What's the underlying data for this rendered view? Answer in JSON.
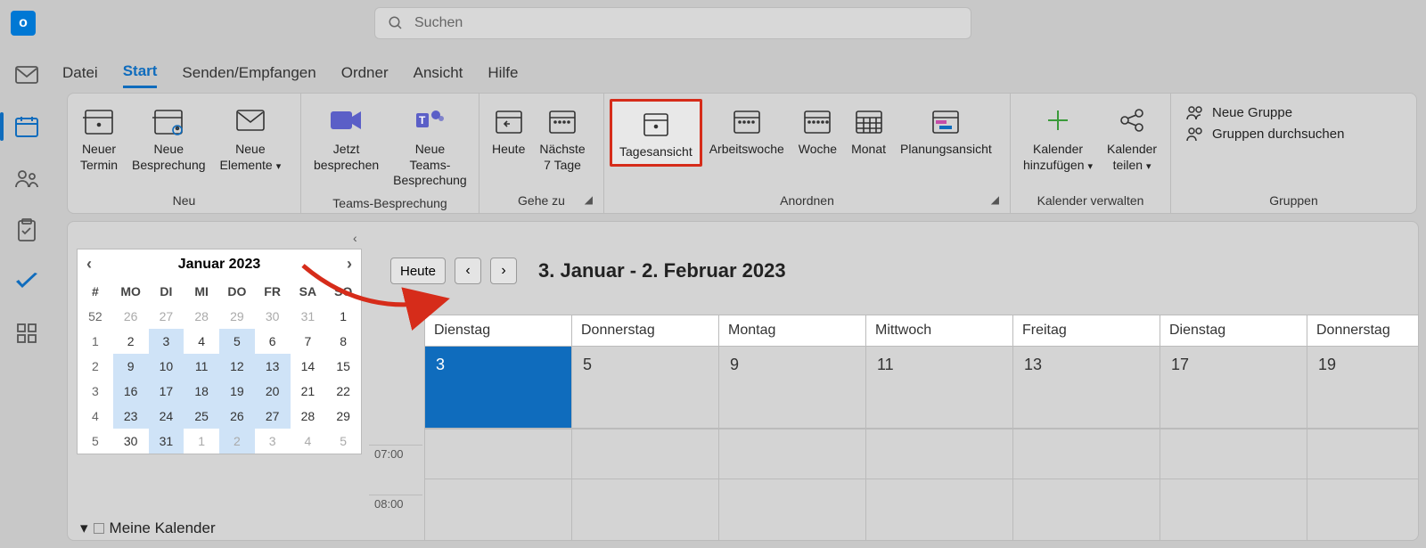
{
  "app": {
    "letter": "o"
  },
  "search": {
    "placeholder": "Suchen"
  },
  "tabs": [
    "Datei",
    "Start",
    "Senden/Empfangen",
    "Ordner",
    "Ansicht",
    "Hilfe"
  ],
  "ribbon": {
    "new": {
      "title": "Neu",
      "appt": "Neuer\nTermin",
      "meeting": "Neue\nBesprechung",
      "items": "Neue\nElemente"
    },
    "teams": {
      "title": "Teams-Besprechung",
      "now": "Jetzt\nbesprechen",
      "new": "Neue Teams-\nBesprechung"
    },
    "goto": {
      "title": "Gehe zu",
      "today": "Heute",
      "next7": "Nächste\n7 Tage"
    },
    "arrange": {
      "title": "Anordnen",
      "day": "Tagesansicht",
      "workweek": "Arbeitswoche",
      "week": "Woche",
      "month": "Monat",
      "schedule": "Planungsansicht"
    },
    "manage": {
      "title": "Kalender verwalten",
      "add": "Kalender\nhinzufügen",
      "share": "Kalender\nteilen"
    },
    "groups": {
      "title": "Gruppen",
      "new": "Neue Gruppe",
      "browse": "Gruppen durchsuchen"
    }
  },
  "mini": {
    "title": "Januar 2023",
    "dow": [
      "#",
      "MO",
      "DI",
      "MI",
      "DO",
      "FR",
      "SA",
      "SO"
    ],
    "rows": [
      {
        "wk": "52",
        "days": [
          26,
          27,
          28,
          29,
          30,
          31,
          1
        ],
        "dim": [
          0,
          1,
          2,
          3,
          4,
          5
        ],
        "hl": []
      },
      {
        "wk": "1",
        "days": [
          2,
          3,
          4,
          5,
          6,
          7,
          8
        ],
        "dim": [],
        "hl": [
          1,
          3
        ]
      },
      {
        "wk": "2",
        "days": [
          9,
          10,
          11,
          12,
          13,
          14,
          15
        ],
        "dim": [],
        "hl": [
          0,
          1,
          2,
          3,
          4
        ]
      },
      {
        "wk": "3",
        "days": [
          16,
          17,
          18,
          19,
          20,
          21,
          22
        ],
        "dim": [],
        "hl": [
          0,
          1,
          2,
          3,
          4
        ]
      },
      {
        "wk": "4",
        "days": [
          23,
          24,
          25,
          26,
          27,
          28,
          29
        ],
        "dim": [],
        "hl": [
          0,
          1,
          2,
          3,
          4
        ]
      },
      {
        "wk": "5",
        "days": [
          30,
          31,
          1,
          2,
          3,
          4,
          5
        ],
        "dim": [
          2,
          3,
          4,
          5,
          6
        ],
        "hl": [
          1,
          3
        ]
      }
    ]
  },
  "myCalendars": "Meine Kalender",
  "toolbar": {
    "today": "Heute",
    "range": "3. Januar - 2. Februar 2023"
  },
  "days": [
    {
      "name": "Dienstag",
      "num": "3",
      "selected": true
    },
    {
      "name": "Donnerstag",
      "num": "5"
    },
    {
      "name": "Montag",
      "num": "9"
    },
    {
      "name": "Mittwoch",
      "num": "11"
    },
    {
      "name": "Freitag",
      "num": "13"
    },
    {
      "name": "Dienstag",
      "num": "17"
    },
    {
      "name": "Donnerstag",
      "num": "19"
    }
  ],
  "times": [
    "07:00",
    "08:00"
  ]
}
